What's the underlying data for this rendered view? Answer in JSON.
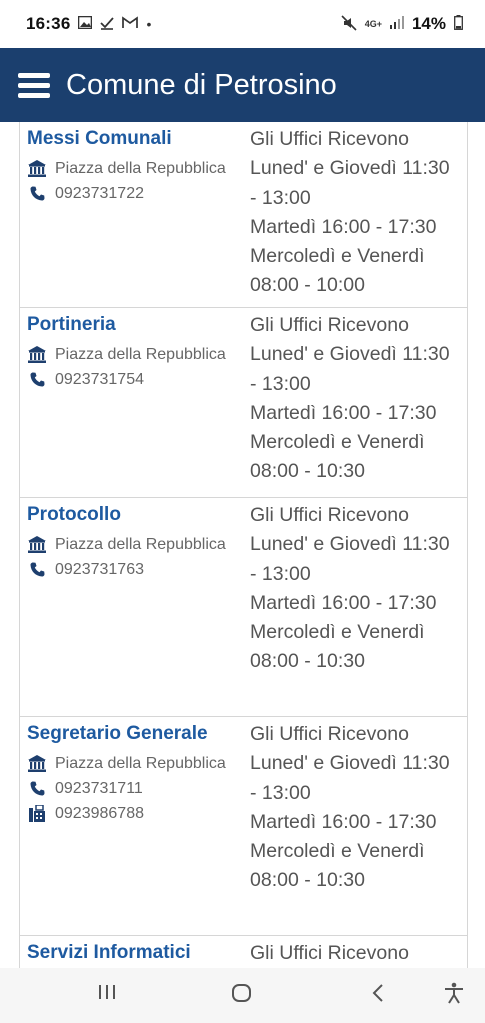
{
  "status_bar": {
    "time": "16:36",
    "network": "4G+",
    "battery": "14%"
  },
  "app_bar": {
    "title": "Comune di Petrosino"
  },
  "offices": [
    {
      "name": "Messi Comunali",
      "address": "Piazza della Repubblica",
      "phone": "0923731722",
      "fax": "",
      "hours": [
        "Gli Uffici Ricevono",
        "Luned' e Giovedì 11:30",
        "- 13:00",
        "Martedì 16:00 - 17:30",
        "Mercoledì e Venerdì",
        "08:00 - 10:00"
      ]
    },
    {
      "name": "Portineria",
      "address": "Piazza della Repubblica",
      "phone": "0923731754",
      "fax": "",
      "hours": [
        "Gli Uffici Ricevono",
        "Luned' e Giovedì 11:30",
        "- 13:00",
        "Martedì 16:00 - 17:30",
        "Mercoledì e Venerdì",
        "08:00 - 10:30"
      ]
    },
    {
      "name": "Protocollo",
      "address": "Piazza della Repubblica",
      "phone": "0923731763",
      "fax": "",
      "hours": [
        "Gli Uffici Ricevono",
        "Luned' e Giovedì 11:30",
        "- 13:00",
        "Martedì 16:00 - 17:30",
        "Mercoledì e Venerdì",
        "08:00 - 10:30"
      ]
    },
    {
      "name": "Segretario Generale",
      "address": "Piazza della Repubblica",
      "phone": "0923731711",
      "fax": "0923986788",
      "hours": [
        "Gli Uffici Ricevono",
        "Luned' e Giovedì 11:30",
        "- 13:00",
        "Martedì 16:00 - 17:30",
        "Mercoledì e Venerdì",
        "08:00 - 10:30"
      ]
    },
    {
      "name": "Servizi Informatici",
      "address": "",
      "phone": "",
      "fax": "",
      "hours": [
        "Gli Uffici Ricevono"
      ]
    }
  ],
  "colors": {
    "app_bar": "#1b3f6e",
    "office_name": "#1e5aa0"
  }
}
